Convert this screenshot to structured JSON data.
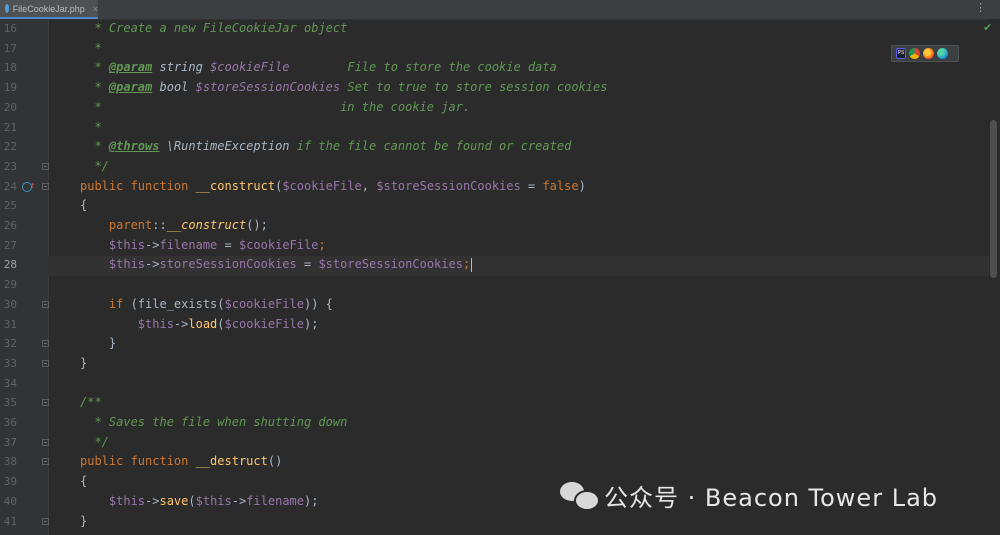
{
  "tab": {
    "file_name": "FileCookieJar.php",
    "close": "×",
    "more": "⋮"
  },
  "status": {
    "inspection": "✔"
  },
  "browsers": [
    "PS",
    "chrome",
    "firefox",
    "edge"
  ],
  "watermark": {
    "text": "公众号 · Beacon Tower Lab"
  },
  "current_line": 28,
  "lines": [
    {
      "n": "16"
    },
    {
      "n": "17"
    },
    {
      "n": "18"
    },
    {
      "n": "19"
    },
    {
      "n": "20"
    },
    {
      "n": "21"
    },
    {
      "n": "22"
    },
    {
      "n": "23"
    },
    {
      "n": "24"
    },
    {
      "n": "25"
    },
    {
      "n": "26"
    },
    {
      "n": "27"
    },
    {
      "n": "28"
    },
    {
      "n": "29"
    },
    {
      "n": "30"
    },
    {
      "n": "31"
    },
    {
      "n": "32"
    },
    {
      "n": "33"
    },
    {
      "n": "34"
    },
    {
      "n": "35"
    },
    {
      "n": "36"
    },
    {
      "n": "37"
    },
    {
      "n": "38"
    },
    {
      "n": "39"
    },
    {
      "n": "40"
    },
    {
      "n": "41"
    }
  ],
  "code": {
    "l16": "  * Create a new FileCookieJar object",
    "l17": "  *",
    "l18a": "  * ",
    "l18tag": "@param",
    "l18ty": " string ",
    "l18v": "$cookieFile",
    "l18c": "        File to store the cookie data",
    "l19a": "  * ",
    "l19tag": "@param",
    "l19ty": " bool ",
    "l19v": "$storeSessionCookies",
    "l19c": " Set to true to store session cookies",
    "l20": "  *                                 in the cookie jar.",
    "l21": "  *",
    "l22a": "  * ",
    "l22tag": "@throws",
    "l22ty": " \\RuntimeException",
    "l22c": " if the file cannot be found or created",
    "l23": "  */",
    "l24k1": "public function ",
    "l24f": "__construct",
    "l24p1": "(",
    "l24v1": "$cookieFile",
    "l24p2": ", ",
    "l24v2": "$storeSessionCookies",
    "l24p3": " = ",
    "l24k2": "false",
    "l24p4": ")",
    "l25": "{",
    "l26k": "    parent",
    "l26p": "::",
    "l26f": "__construct",
    "l26e": "();",
    "l27v1": "    $this",
    "l27p1": "->",
    "l27v2": "filename",
    "l27p2": " = ",
    "l27v3": "$cookieFile",
    "l27e": ";",
    "l28v1": "    $this",
    "l28p1": "->",
    "l28v2": "storeSessionCookies",
    "l28p2": " = ",
    "l28v3": "$storeSessionCookies",
    "l28e": ";",
    "l30k": "    if ",
    "l30p1": "(file_exists(",
    "l30v": "$cookieFile",
    "l30p2": ")) {",
    "l31v1": "        $this",
    "l31p1": "->",
    "l31f": "load",
    "l31p2": "(",
    "l31v2": "$cookieFile",
    "l31e": ");",
    "l32": "    }",
    "l33": "}",
    "l35": "/**",
    "l36": "  * Saves the file when shutting down",
    "l37": "  */",
    "l38k": "public function ",
    "l38f": "__destruct",
    "l38e": "()",
    "l39": "{",
    "l40v1": "    $this",
    "l40p1": "->",
    "l40f": "save",
    "l40p2": "(",
    "l40v2": "$this",
    "l40p3": "->",
    "l40v3": "filename",
    "l40e": ");",
    "l41": "}"
  }
}
